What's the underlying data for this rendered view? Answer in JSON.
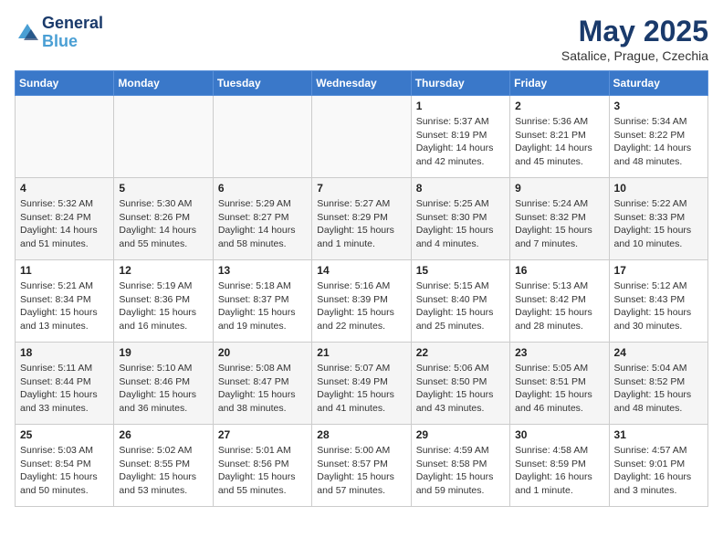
{
  "header": {
    "logo_line1": "General",
    "logo_line2": "Blue",
    "month": "May 2025",
    "location": "Satalice, Prague, Czechia"
  },
  "weekdays": [
    "Sunday",
    "Monday",
    "Tuesday",
    "Wednesday",
    "Thursday",
    "Friday",
    "Saturday"
  ],
  "weeks": [
    [
      {
        "day": "",
        "info": ""
      },
      {
        "day": "",
        "info": ""
      },
      {
        "day": "",
        "info": ""
      },
      {
        "day": "",
        "info": ""
      },
      {
        "day": "1",
        "info": "Sunrise: 5:37 AM\nSunset: 8:19 PM\nDaylight: 14 hours\nand 42 minutes."
      },
      {
        "day": "2",
        "info": "Sunrise: 5:36 AM\nSunset: 8:21 PM\nDaylight: 14 hours\nand 45 minutes."
      },
      {
        "day": "3",
        "info": "Sunrise: 5:34 AM\nSunset: 8:22 PM\nDaylight: 14 hours\nand 48 minutes."
      }
    ],
    [
      {
        "day": "4",
        "info": "Sunrise: 5:32 AM\nSunset: 8:24 PM\nDaylight: 14 hours\nand 51 minutes."
      },
      {
        "day": "5",
        "info": "Sunrise: 5:30 AM\nSunset: 8:26 PM\nDaylight: 14 hours\nand 55 minutes."
      },
      {
        "day": "6",
        "info": "Sunrise: 5:29 AM\nSunset: 8:27 PM\nDaylight: 14 hours\nand 58 minutes."
      },
      {
        "day": "7",
        "info": "Sunrise: 5:27 AM\nSunset: 8:29 PM\nDaylight: 15 hours\nand 1 minute."
      },
      {
        "day": "8",
        "info": "Sunrise: 5:25 AM\nSunset: 8:30 PM\nDaylight: 15 hours\nand 4 minutes."
      },
      {
        "day": "9",
        "info": "Sunrise: 5:24 AM\nSunset: 8:32 PM\nDaylight: 15 hours\nand 7 minutes."
      },
      {
        "day": "10",
        "info": "Sunrise: 5:22 AM\nSunset: 8:33 PM\nDaylight: 15 hours\nand 10 minutes."
      }
    ],
    [
      {
        "day": "11",
        "info": "Sunrise: 5:21 AM\nSunset: 8:34 PM\nDaylight: 15 hours\nand 13 minutes."
      },
      {
        "day": "12",
        "info": "Sunrise: 5:19 AM\nSunset: 8:36 PM\nDaylight: 15 hours\nand 16 minutes."
      },
      {
        "day": "13",
        "info": "Sunrise: 5:18 AM\nSunset: 8:37 PM\nDaylight: 15 hours\nand 19 minutes."
      },
      {
        "day": "14",
        "info": "Sunrise: 5:16 AM\nSunset: 8:39 PM\nDaylight: 15 hours\nand 22 minutes."
      },
      {
        "day": "15",
        "info": "Sunrise: 5:15 AM\nSunset: 8:40 PM\nDaylight: 15 hours\nand 25 minutes."
      },
      {
        "day": "16",
        "info": "Sunrise: 5:13 AM\nSunset: 8:42 PM\nDaylight: 15 hours\nand 28 minutes."
      },
      {
        "day": "17",
        "info": "Sunrise: 5:12 AM\nSunset: 8:43 PM\nDaylight: 15 hours\nand 30 minutes."
      }
    ],
    [
      {
        "day": "18",
        "info": "Sunrise: 5:11 AM\nSunset: 8:44 PM\nDaylight: 15 hours\nand 33 minutes."
      },
      {
        "day": "19",
        "info": "Sunrise: 5:10 AM\nSunset: 8:46 PM\nDaylight: 15 hours\nand 36 minutes."
      },
      {
        "day": "20",
        "info": "Sunrise: 5:08 AM\nSunset: 8:47 PM\nDaylight: 15 hours\nand 38 minutes."
      },
      {
        "day": "21",
        "info": "Sunrise: 5:07 AM\nSunset: 8:49 PM\nDaylight: 15 hours\nand 41 minutes."
      },
      {
        "day": "22",
        "info": "Sunrise: 5:06 AM\nSunset: 8:50 PM\nDaylight: 15 hours\nand 43 minutes."
      },
      {
        "day": "23",
        "info": "Sunrise: 5:05 AM\nSunset: 8:51 PM\nDaylight: 15 hours\nand 46 minutes."
      },
      {
        "day": "24",
        "info": "Sunrise: 5:04 AM\nSunset: 8:52 PM\nDaylight: 15 hours\nand 48 minutes."
      }
    ],
    [
      {
        "day": "25",
        "info": "Sunrise: 5:03 AM\nSunset: 8:54 PM\nDaylight: 15 hours\nand 50 minutes."
      },
      {
        "day": "26",
        "info": "Sunrise: 5:02 AM\nSunset: 8:55 PM\nDaylight: 15 hours\nand 53 minutes."
      },
      {
        "day": "27",
        "info": "Sunrise: 5:01 AM\nSunset: 8:56 PM\nDaylight: 15 hours\nand 55 minutes."
      },
      {
        "day": "28",
        "info": "Sunrise: 5:00 AM\nSunset: 8:57 PM\nDaylight: 15 hours\nand 57 minutes."
      },
      {
        "day": "29",
        "info": "Sunrise: 4:59 AM\nSunset: 8:58 PM\nDaylight: 15 hours\nand 59 minutes."
      },
      {
        "day": "30",
        "info": "Sunrise: 4:58 AM\nSunset: 8:59 PM\nDaylight: 16 hours\nand 1 minute."
      },
      {
        "day": "31",
        "info": "Sunrise: 4:57 AM\nSunset: 9:01 PM\nDaylight: 16 hours\nand 3 minutes."
      }
    ]
  ]
}
